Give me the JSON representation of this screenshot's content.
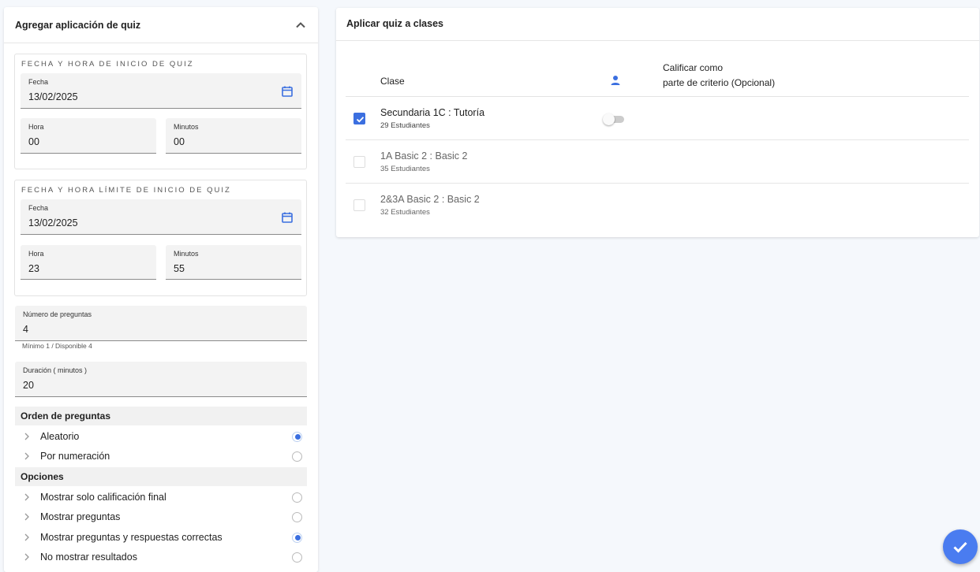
{
  "left_panel": {
    "title": "Agregar aplicación de quiz",
    "start_group": {
      "title": "FECHA Y HORA DE INICIO DE QUIZ",
      "date_label": "Fecha",
      "date_value": "13/02/2025",
      "hour_label": "Hora",
      "hour_value": "00",
      "minutes_label": "Minutos",
      "minutes_value": "00"
    },
    "limit_group": {
      "title": "FECHA Y HORA LÍMITE DE INICIO DE QUIZ",
      "date_label": "Fecha",
      "date_value": "13/02/2025",
      "hour_label": "Hora",
      "hour_value": "23",
      "minutes_label": "Minutos",
      "minutes_value": "55"
    },
    "questions": {
      "label": "Número de preguntas",
      "value": "4",
      "hint": "Mínimo 1 / Disponible 4"
    },
    "duration": {
      "label": "Duración ( minutos )",
      "value": "20"
    },
    "order": {
      "title": "Orden de preguntas",
      "options": [
        {
          "label": "Aleatorio",
          "selected": true
        },
        {
          "label": "Por numeración",
          "selected": false
        }
      ]
    },
    "options": {
      "title": "Opciones",
      "options": [
        {
          "label": "Mostrar solo calificación final",
          "selected": false
        },
        {
          "label": "Mostrar preguntas",
          "selected": false
        },
        {
          "label": "Mostrar preguntas y respuestas correctas",
          "selected": true
        },
        {
          "label": "No mostrar resultados",
          "selected": false
        }
      ]
    }
  },
  "right_panel": {
    "title": "Aplicar quiz a clases",
    "columns": {
      "class": "Clase",
      "grade_line1": "Calificar como",
      "grade_line2": "parte de criterio (Opcional)"
    },
    "rows": [
      {
        "name": "Secundaria 1C : Tutoría",
        "students": "29 Estudiantes",
        "checked": true,
        "toggle": false
      },
      {
        "name": "1A Basic 2 : Basic 2",
        "students": "35 Estudiantes",
        "checked": false
      },
      {
        "name": "2&3A Basic 2 : Basic 2",
        "students": "32 Estudiantes",
        "checked": false
      }
    ]
  },
  "colors": {
    "accent": "#3b6fe0",
    "fab": "#4a7cf0"
  },
  "icons": {
    "collapse": "chevron-up-icon",
    "calendar": "calendar-icon",
    "person": "person-icon",
    "confirm": "check-icon"
  }
}
